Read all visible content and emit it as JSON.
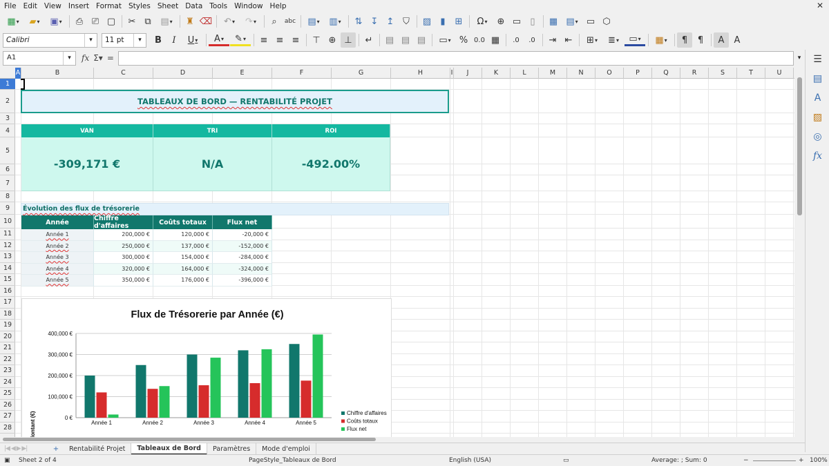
{
  "menubar": {
    "items": [
      "File",
      "Edit",
      "View",
      "Insert",
      "Format",
      "Styles",
      "Sheet",
      "Data",
      "Tools",
      "Window",
      "Help"
    ]
  },
  "toolbar2": {
    "font_name": "Calibri",
    "font_size": "11 pt"
  },
  "formula": {
    "cell_ref": "A1",
    "content": ""
  },
  "columns": [
    "A",
    "B",
    "C",
    "D",
    "E",
    "F",
    "G",
    "H",
    "I",
    "J",
    "K",
    "L",
    "M",
    "N",
    "O",
    "P",
    "Q",
    "R",
    "S",
    "T",
    "U"
  ],
  "rows": [
    "1",
    "2",
    "3",
    "4",
    "5",
    "6",
    "7",
    "8",
    "9",
    "10",
    "11",
    "12",
    "13",
    "14",
    "15",
    "16",
    "17",
    "18",
    "19",
    "20",
    "21",
    "22",
    "23",
    "24",
    "25",
    "26",
    "27",
    "28"
  ],
  "sheet": {
    "title": "TABLEAUX DE BORD — RENTABILITÉ PROJET",
    "kpis": [
      {
        "label": "VAN",
        "value": "-309,171 €"
      },
      {
        "label": "TRI",
        "value": "N/A"
      },
      {
        "label": "ROI",
        "value": "-492.00%"
      }
    ],
    "section_title": "Évolution des flux de trésorerie",
    "table": {
      "headers": [
        "Année",
        "Chiffre d'affaires",
        "Coûts totaux",
        "Flux net"
      ],
      "rows": [
        [
          "Année 1",
          "200,000 €",
          "120,000 €",
          "-20,000 €"
        ],
        [
          "Année 2",
          "250,000 €",
          "137,000 €",
          "-152,000 €"
        ],
        [
          "Année 3",
          "300,000 €",
          "154,000 €",
          "-284,000 €"
        ],
        [
          "Année 4",
          "320,000 €",
          "164,000 €",
          "-324,000 €"
        ],
        [
          "Année 5",
          "350,000 €",
          "176,000 €",
          "-396,000 €"
        ]
      ]
    }
  },
  "chart_data": {
    "type": "bar",
    "title": "Flux de Trésorerie par Année (€)",
    "ylabel": "Montant (€)",
    "xlabel": "",
    "categories": [
      "Année 1",
      "Année 2",
      "Année 3",
      "Année 4",
      "Année 5"
    ],
    "series": [
      {
        "name": "Chiffre d'affaires",
        "color": "#11776c",
        "values": [
          200000,
          250000,
          300000,
          320000,
          350000
        ]
      },
      {
        "name": "Coûts totaux",
        "color": "#d62c2c",
        "values": [
          120000,
          137000,
          154000,
          164000,
          176000
        ]
      },
      {
        "name": "Flux net",
        "color": "#25c45a",
        "values": [
          15000,
          150000,
          285000,
          325000,
          395000
        ]
      }
    ],
    "yticks": [
      "0 €",
      "100,000 €",
      "200,000 €",
      "300,000 €",
      "400,000 €"
    ],
    "ylim": [
      0,
      400000
    ],
    "grid": true,
    "legend": "bottom-right"
  },
  "tabs": [
    "Rentabilité Projet",
    "Tableaux de Bord",
    "Paramètres",
    "Mode d'emploi"
  ],
  "active_tab": 1,
  "status": {
    "sheet": "Sheet 2 of 4",
    "page_style": "PageStyle_Tableaux de Bord",
    "language": "English (USA)",
    "sum": "Average: ; Sum: 0",
    "zoom": "100%"
  },
  "colors": {
    "teal_dark": "#11776c",
    "teal": "#14b8a0",
    "mint": "#cef8ee",
    "light_blue": "#e3f1fb",
    "selection": "#3d7bd6"
  }
}
